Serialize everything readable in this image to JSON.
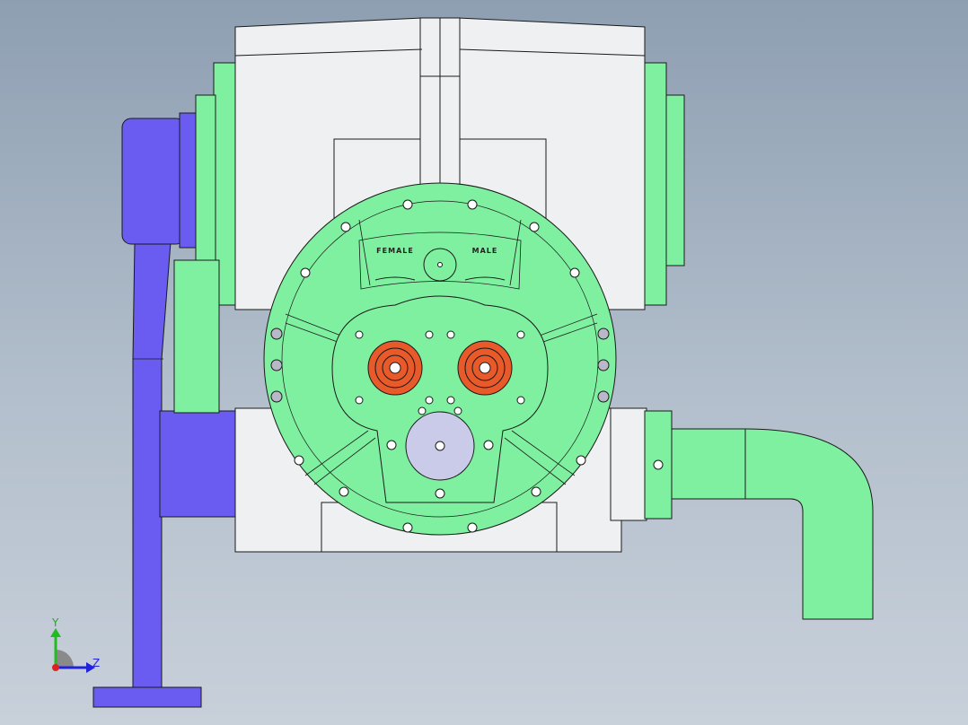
{
  "model": {
    "port_labels": {
      "female": "FEMALE",
      "male": "MALE"
    }
  },
  "triad": {
    "y_label": "Y",
    "z_label": "Z"
  },
  "colors": {
    "background_top": "#8e9fb2",
    "background_bottom": "#c8d0da",
    "housing": "#eef0f2",
    "end_cover": "#7ef0a0",
    "pipe": "#7ef0a0",
    "motor_bracket": "#6a5cf0",
    "rotor": "#e85a2a",
    "shaft_hub": "#c9cbe8",
    "outline": "#1a1a1a"
  }
}
